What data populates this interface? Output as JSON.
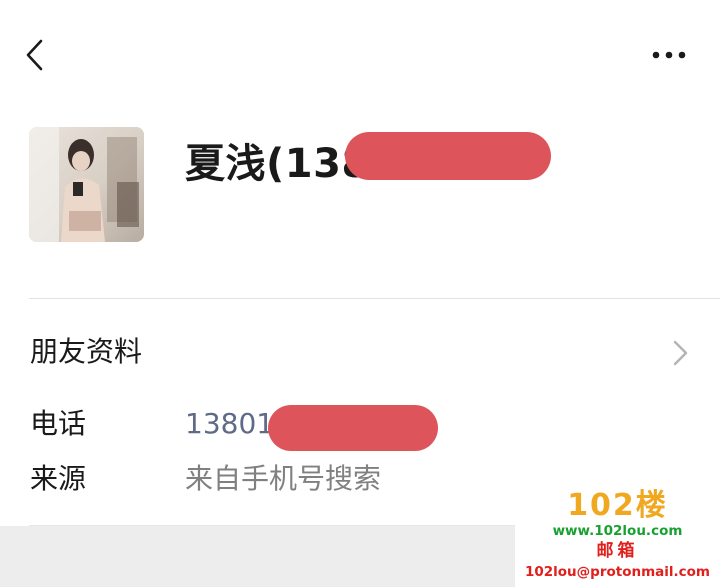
{
  "header": {
    "back_icon": "chevron-left-icon",
    "more_icon": "more-horizontal-icon"
  },
  "profile": {
    "name": "夏浅(1380"
  },
  "friend_info": {
    "label": "朋友资料",
    "icon": "chevron-right-icon"
  },
  "details": {
    "phone_label": "电话",
    "phone_value": "13801",
    "source_label": "来源",
    "source_value": "来自手机号搜索"
  },
  "watermark": {
    "title": "102楼",
    "site": "www.102lou.com",
    "mail_label": "邮箱",
    "mail": "102lou@protonmail.com"
  },
  "colors": {
    "redaction": "#dd555b",
    "link_value": "#5f6a86",
    "secondary_text": "#808080",
    "watermark_orange": "#f0a820",
    "watermark_green": "#18a030",
    "watermark_red": "#e0201c"
  }
}
